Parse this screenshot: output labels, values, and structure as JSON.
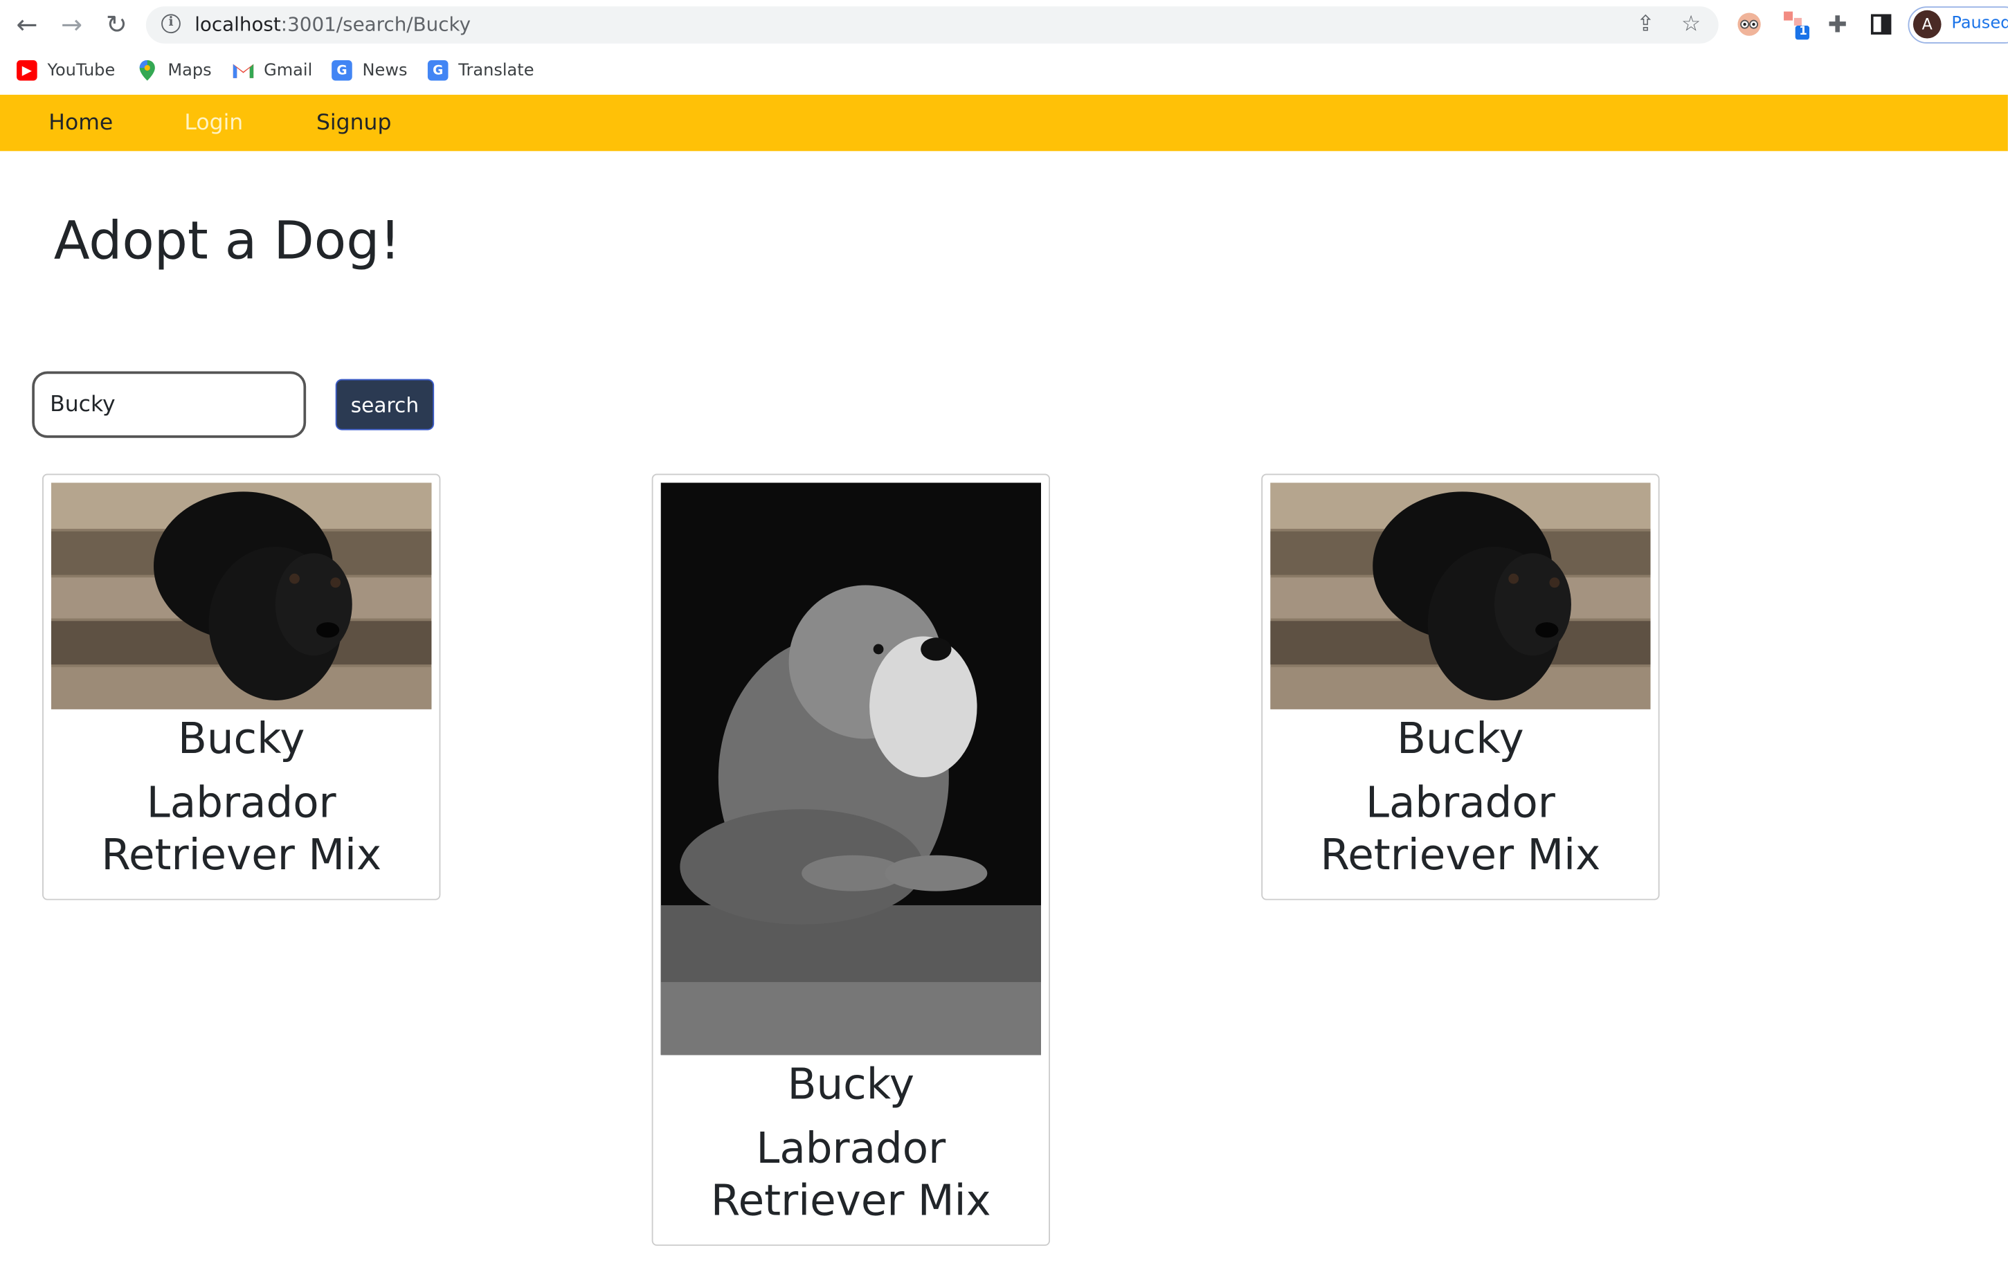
{
  "browser": {
    "url_host": "localhost",
    "url_path": ":3001/search/Bucky",
    "profile_initial": "A",
    "profile_status": "Paused",
    "extension_badge": "1",
    "bookmarks": [
      {
        "label": "YouTube",
        "icon": "youtube-icon",
        "color": "#ff0000"
      },
      {
        "label": "Maps",
        "icon": "maps-icon",
        "color": "#34a853"
      },
      {
        "label": "Gmail",
        "icon": "gmail-icon",
        "color": "#ea4335"
      },
      {
        "label": "News",
        "icon": "news-icon",
        "color": "#4285f4"
      },
      {
        "label": "Translate",
        "icon": "translate-icon",
        "color": "#4285f4"
      }
    ]
  },
  "navbar": {
    "background": "#ffc107",
    "items": [
      {
        "label": "Home",
        "color": "#212529"
      },
      {
        "label": "Login",
        "color": "#fff3c4"
      },
      {
        "label": "Signup",
        "color": "#212529"
      }
    ]
  },
  "page": {
    "title": "Adopt a Dog!"
  },
  "search": {
    "value": "Bucky",
    "button_label": "search"
  },
  "results": [
    {
      "name": "Bucky",
      "breed": "Labrador Retriever Mix",
      "photo": "black-labrador-puppy-photo"
    },
    {
      "name": "Bucky",
      "breed": "Labrador Retriever Mix",
      "photo": "grey-schnauzer-photo"
    },
    {
      "name": "Bucky",
      "breed": "Labrador Retriever Mix",
      "photo": "black-labrador-puppy-photo"
    }
  ]
}
